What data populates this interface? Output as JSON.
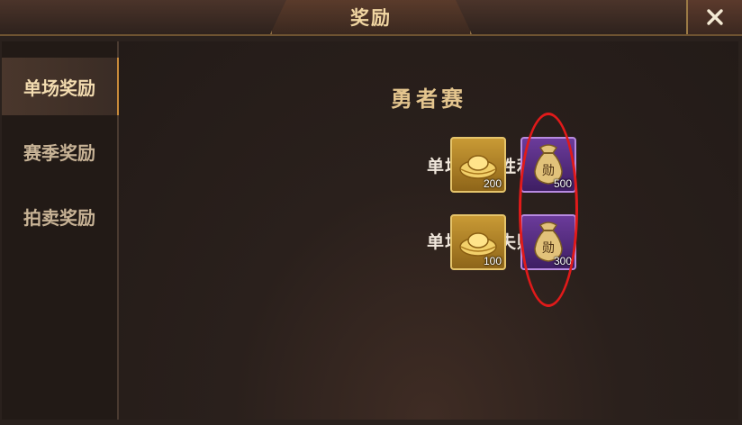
{
  "window": {
    "title": "奖励"
  },
  "tabs": [
    {
      "label": "单场奖励",
      "active": true
    },
    {
      "label": "赛季奖励",
      "active": false
    },
    {
      "label": "拍卖奖励",
      "active": false
    }
  ],
  "content": {
    "heading": "勇者赛",
    "rows": [
      {
        "label": "单场竞赛胜利：",
        "rewards": [
          {
            "icon": "gold-ingot-icon",
            "quantity": "200"
          },
          {
            "icon": "medal-bag-icon",
            "quantity": "500"
          }
        ]
      },
      {
        "label": "单场竞赛失败：",
        "rewards": [
          {
            "icon": "gold-ingot-icon",
            "quantity": "100"
          },
          {
            "icon": "medal-bag-icon",
            "quantity": "300"
          }
        ]
      }
    ],
    "bag_glyph": "勋"
  },
  "colors": {
    "accent": "#c88a3a",
    "highlight": "#e01a1a"
  }
}
